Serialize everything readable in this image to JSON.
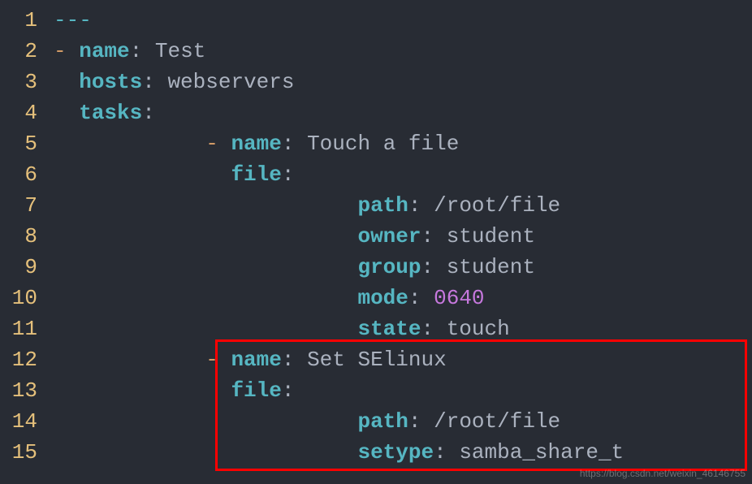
{
  "watermark": "https://blog.csdn.net/weixin_46146755",
  "lines": [
    {
      "num": "1",
      "tokens": [
        {
          "t": "---",
          "c": "yaml-start"
        }
      ]
    },
    {
      "num": "2",
      "tokens": [
        {
          "t": "- ",
          "c": "dash"
        },
        {
          "t": "name",
          "c": "keyword"
        },
        {
          "t": ": ",
          "c": "colon"
        },
        {
          "t": "Test",
          "c": "string"
        }
      ]
    },
    {
      "num": "3",
      "tokens": [
        {
          "t": "  ",
          "c": ""
        },
        {
          "t": "hosts",
          "c": "keyword"
        },
        {
          "t": ": ",
          "c": "colon"
        },
        {
          "t": "webservers",
          "c": "string"
        }
      ]
    },
    {
      "num": "4",
      "tokens": [
        {
          "t": "  ",
          "c": ""
        },
        {
          "t": "tasks",
          "c": "keyword"
        },
        {
          "t": ":",
          "c": "colon"
        }
      ]
    },
    {
      "num": "5",
      "tokens": [
        {
          "t": "            - ",
          "c": "dash"
        },
        {
          "t": "name",
          "c": "keyword"
        },
        {
          "t": ": ",
          "c": "colon"
        },
        {
          "t": "Touch a file",
          "c": "string"
        }
      ]
    },
    {
      "num": "6",
      "tokens": [
        {
          "t": "              ",
          "c": ""
        },
        {
          "t": "file",
          "c": "keyword"
        },
        {
          "t": ":",
          "c": "colon"
        }
      ]
    },
    {
      "num": "7",
      "tokens": [
        {
          "t": "                        ",
          "c": ""
        },
        {
          "t": "path",
          "c": "keyword"
        },
        {
          "t": ": ",
          "c": "colon"
        },
        {
          "t": "/root/file",
          "c": "string"
        }
      ]
    },
    {
      "num": "8",
      "tokens": [
        {
          "t": "                        ",
          "c": ""
        },
        {
          "t": "owner",
          "c": "keyword"
        },
        {
          "t": ": ",
          "c": "colon"
        },
        {
          "t": "student",
          "c": "string"
        }
      ]
    },
    {
      "num": "9",
      "tokens": [
        {
          "t": "                        ",
          "c": ""
        },
        {
          "t": "group",
          "c": "keyword"
        },
        {
          "t": ": ",
          "c": "colon"
        },
        {
          "t": "student",
          "c": "string"
        }
      ]
    },
    {
      "num": "10",
      "tokens": [
        {
          "t": "                        ",
          "c": ""
        },
        {
          "t": "mode",
          "c": "keyword"
        },
        {
          "t": ": ",
          "c": "colon"
        },
        {
          "t": "0640",
          "c": "number"
        }
      ]
    },
    {
      "num": "11",
      "tokens": [
        {
          "t": "                        ",
          "c": ""
        },
        {
          "t": "state",
          "c": "keyword"
        },
        {
          "t": ": ",
          "c": "colon"
        },
        {
          "t": "touch",
          "c": "string"
        }
      ]
    },
    {
      "num": "12",
      "tokens": [
        {
          "t": "            - ",
          "c": "dash"
        },
        {
          "t": "name",
          "c": "keyword"
        },
        {
          "t": ": ",
          "c": "colon"
        },
        {
          "t": "Set SElinux",
          "c": "string"
        }
      ]
    },
    {
      "num": "13",
      "tokens": [
        {
          "t": "              ",
          "c": ""
        },
        {
          "t": "file",
          "c": "keyword"
        },
        {
          "t": ":",
          "c": "colon"
        }
      ]
    },
    {
      "num": "14",
      "tokens": [
        {
          "t": "                        ",
          "c": ""
        },
        {
          "t": "path",
          "c": "keyword"
        },
        {
          "t": ": ",
          "c": "colon"
        },
        {
          "t": "/root/file",
          "c": "string"
        }
      ]
    },
    {
      "num": "15",
      "tokens": [
        {
          "t": "                        ",
          "c": ""
        },
        {
          "t": "setype",
          "c": "keyword"
        },
        {
          "t": ": ",
          "c": "colon"
        },
        {
          "t": "samba_share_t",
          "c": "string"
        }
      ]
    }
  ]
}
